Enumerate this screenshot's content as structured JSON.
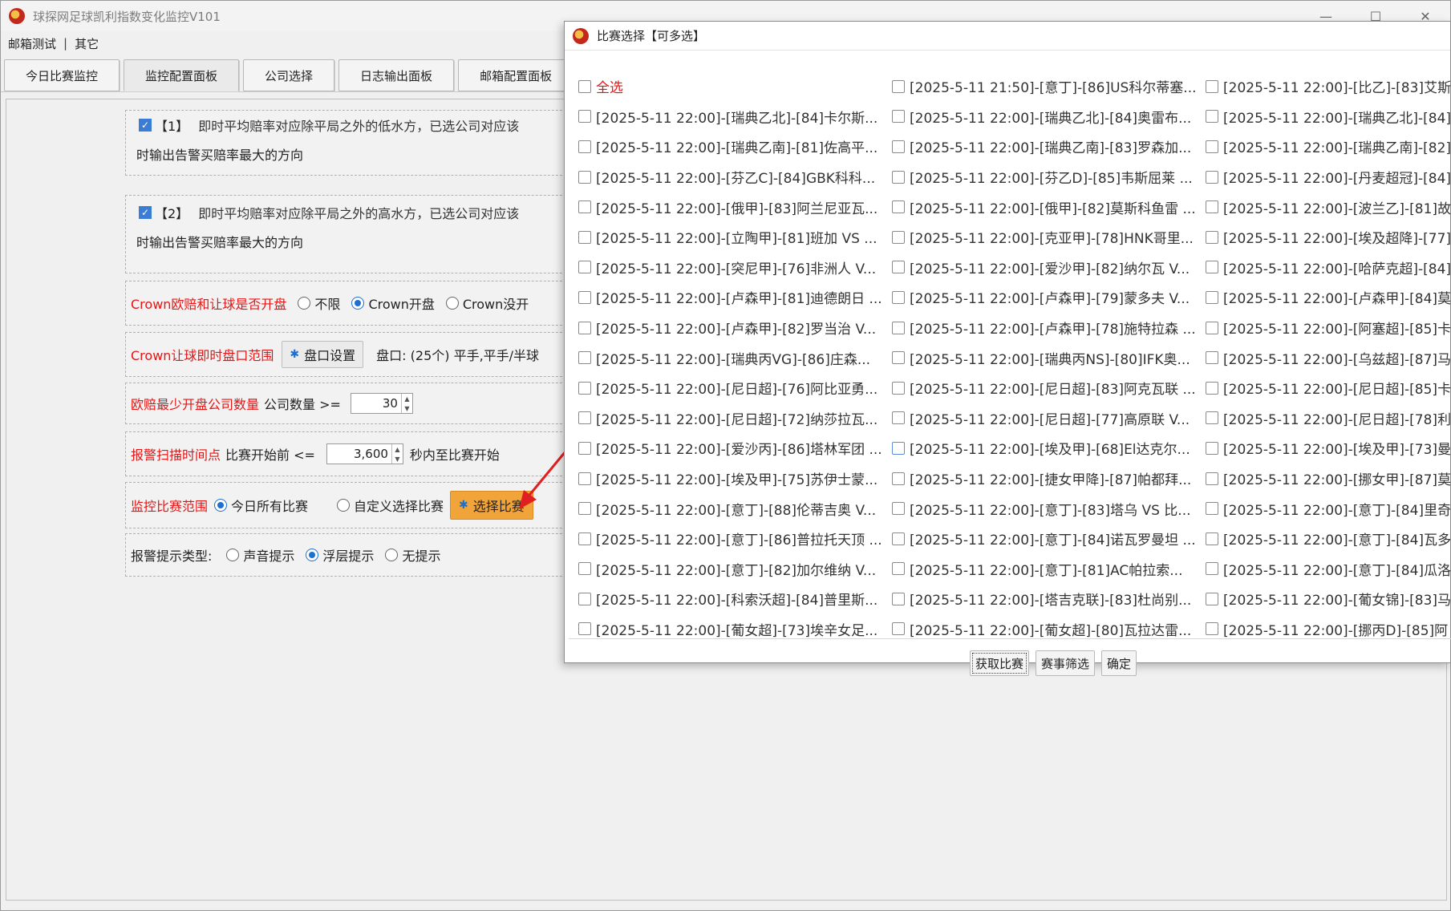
{
  "main": {
    "title": "球探网足球凯利指数变化监控V101",
    "window_controls": [
      "—",
      "☐",
      "✕"
    ],
    "menu": [
      "邮箱测试",
      "其它"
    ],
    "menu_separator": "|",
    "tabs": [
      "今日比赛监控",
      "监控配置面板",
      "公司选择",
      "日志输出面板",
      "邮箱配置面板"
    ],
    "rule1": {
      "tag": "【1】",
      "text": "即时平均赔率对应除平局之外的低水方，已选公司对应该",
      "text2": "时输出告警买赔率最大的方向"
    },
    "rule2": {
      "tag": "【2】",
      "text": "即时平均赔率对应除平局之外的高水方，已选公司对应该",
      "text2": "时输出告警买赔率最大的方向"
    },
    "crown_open": {
      "label": "Crown欧赔和让球是否开盘",
      "opt1": "不限",
      "opt2": "Crown开盘",
      "opt3": "Crown没开"
    },
    "crown_range": {
      "label": "Crown让球即时盘口范围",
      "button": "盘口设置",
      "info": "盘口: (25个) 平手,平手/半球"
    },
    "min_company": {
      "label": "欧赔最少开盘公司数量",
      "prefix": "公司数量 >=",
      "value": "30"
    },
    "scan_time": {
      "label": "报警扫描时间点",
      "prefix": "比赛开始前 <=",
      "value": "3,600",
      "suffix": "秒内至比赛开始"
    },
    "scope": {
      "label": "监控比赛范围",
      "opt1": "今日所有比赛",
      "opt2": "自定义选择比赛",
      "button": "选择比赛"
    },
    "alert": {
      "label": "报警提示类型:",
      "opt1": "声音提示",
      "opt2": "浮层提示",
      "opt3": "无提示"
    }
  },
  "dialog": {
    "title": "比赛选择【可多选】",
    "select_all": "全选",
    "col1": [
      "[2025-5-11 22:00]-[瑞典乙北]-[84]卡尔斯...",
      "[2025-5-11 22:00]-[瑞典乙南]-[81]佐高平...",
      "[2025-5-11 22:00]-[芬乙C]-[84]GBK科科...",
      "[2025-5-11 22:00]-[俄甲]-[83]阿兰尼亚瓦...",
      "[2025-5-11 22:00]-[立陶甲]-[81]班加 VS ...",
      "[2025-5-11 22:00]-[突尼甲]-[76]非洲人 V...",
      "[2025-5-11 22:00]-[卢森甲]-[81]迪德朗日 ...",
      "[2025-5-11 22:00]-[卢森甲]-[82]罗当治 V...",
      "[2025-5-11 22:00]-[瑞典丙VG]-[86]庄森...",
      "[2025-5-11 22:00]-[尼日超]-[76]阿比亚勇...",
      "[2025-5-11 22:00]-[尼日超]-[72]纳莎拉瓦...",
      "[2025-5-11 22:00]-[爱沙丙]-[86]塔林军团 ...",
      "[2025-5-11 22:00]-[埃及甲]-[75]苏伊士蒙...",
      "[2025-5-11 22:00]-[意丁]-[88]伦蒂吉奥 V...",
      "[2025-5-11 22:00]-[意丁]-[86]普拉托天顶 ...",
      "[2025-5-11 22:00]-[意丁]-[82]加尔维纳 V...",
      "[2025-5-11 22:00]-[科索沃超]-[84]普里斯...",
      "[2025-5-11 22:00]-[葡女超]-[73]埃辛女足..."
    ],
    "col2": [
      "[2025-5-11 21:50]-[意丁]-[86]US科尔蒂塞...",
      "[2025-5-11 22:00]-[瑞典乙北]-[84]奥雷布...",
      "[2025-5-11 22:00]-[瑞典乙南]-[83]罗森加...",
      "[2025-5-11 22:00]-[芬乙D]-[85]韦斯屈莱 ...",
      "[2025-5-11 22:00]-[俄甲]-[82]莫斯科鱼雷 ...",
      "[2025-5-11 22:00]-[克亚甲]-[78]HNK哥里...",
      "[2025-5-11 22:00]-[爱沙甲]-[82]纳尔瓦 V...",
      "[2025-5-11 22:00]-[卢森甲]-[79]蒙多夫 V...",
      "[2025-5-11 22:00]-[卢森甲]-[78]施特拉森 ...",
      "[2025-5-11 22:00]-[瑞典丙NS]-[80]IFK奥...",
      "[2025-5-11 22:00]-[尼日超]-[83]阿克瓦联 ...",
      "[2025-5-11 22:00]-[尼日超]-[77]高原联 V...",
      "[2025-5-11 22:00]-[埃及甲]-[68]El达克尔...",
      "[2025-5-11 22:00]-[捷女甲降]-[87]帕都拜...",
      "[2025-5-11 22:00]-[意丁]-[83]塔乌 VS 比...",
      "[2025-5-11 22:00]-[意丁]-[84]诺瓦罗曼坦 ...",
      "[2025-5-11 22:00]-[意丁]-[81]AC帕拉索...",
      "[2025-5-11 22:00]-[塔吉克联]-[83]杜尚别...",
      "[2025-5-11 22:00]-[葡女超]-[80]瓦拉达雷..."
    ],
    "col3": [
      "[2025-5-11 22:00]-[比乙]-[83]艾斯",
      "[2025-5-11 22:00]-[瑞典乙北]-[84]",
      "[2025-5-11 22:00]-[瑞典乙南]-[82]",
      "[2025-5-11 22:00]-[丹麦超冠]-[84]",
      "[2025-5-11 22:00]-[波兰乙]-[81]故",
      "[2025-5-11 22:00]-[埃及超降]-[77]",
      "[2025-5-11 22:00]-[哈萨克超]-[84]",
      "[2025-5-11 22:00]-[卢森甲]-[84]莫",
      "[2025-5-11 22:00]-[阿塞超]-[85]卡",
      "[2025-5-11 22:00]-[乌兹超]-[87]马",
      "[2025-5-11 22:00]-[尼日超]-[85]卡",
      "[2025-5-11 22:00]-[尼日超]-[78]利",
      "[2025-5-11 22:00]-[埃及甲]-[73]曼",
      "[2025-5-11 22:00]-[挪女甲]-[87]莫",
      "[2025-5-11 22:00]-[意丁]-[84]里奇",
      "[2025-5-11 22:00]-[意丁]-[84]瓦多",
      "[2025-5-11 22:00]-[意丁]-[84]瓜洛",
      "[2025-5-11 22:00]-[葡女锦]-[83]马",
      "[2025-5-11 22:00]-[挪丙D]-[85]阿"
    ],
    "buttons": [
      "获取比赛",
      "赛事筛选",
      "确定"
    ]
  }
}
